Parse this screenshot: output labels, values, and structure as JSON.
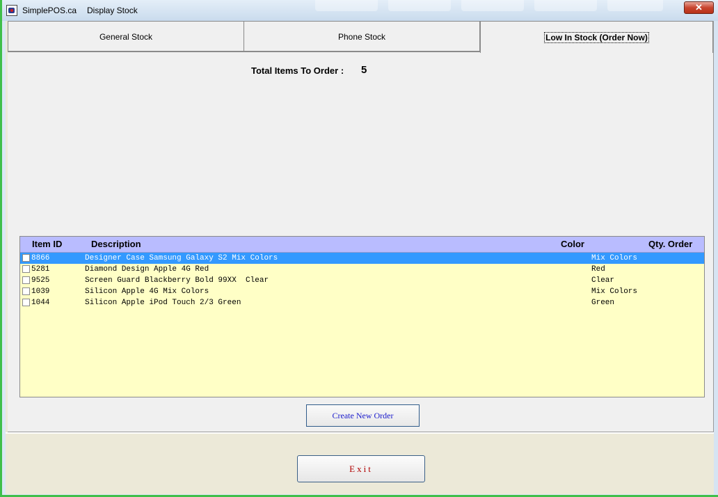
{
  "window": {
    "app_name": "SimplePOS.ca",
    "title": "Display Stock",
    "close_label": "✕"
  },
  "tabs": [
    {
      "label": "General Stock",
      "active": false
    },
    {
      "label": "Phone Stock",
      "active": false
    },
    {
      "label": "Low In Stock (Order Now)",
      "active": true
    }
  ],
  "summary": {
    "total_label": "Total Items To Order :",
    "total_value": "5"
  },
  "grid": {
    "headers": {
      "item_id": "Item ID",
      "description": "Description",
      "color": "Color",
      "qty": "Qty. Order"
    },
    "rows": [
      {
        "id": "8866",
        "description": "Designer Case Samsung Galaxy S2 Mix Colors",
        "color": "Mix Colors",
        "qty": "",
        "selected": true
      },
      {
        "id": "5281",
        "description": "Diamond Design Apple 4G Red",
        "color": "Red",
        "qty": "",
        "selected": false
      },
      {
        "id": "9525",
        "description": "Screen Guard Blackberry Bold 99XX  Clear",
        "color": "Clear",
        "qty": "",
        "selected": false
      },
      {
        "id": "1039",
        "description": "Silicon Apple 4G Mix Colors",
        "color": "Mix Colors",
        "qty": "",
        "selected": false
      },
      {
        "id": "1044",
        "description": "Silicon Apple iPod Touch 2/3 Green",
        "color": "Green",
        "qty": "",
        "selected": false
      }
    ]
  },
  "buttons": {
    "create_order": "Create New Order",
    "exit": "Exit"
  },
  "colors": {
    "grid_background": "#ffffc6",
    "grid_header": "#b9bcff",
    "selection": "#3399ff",
    "create_text": "#1a1acc",
    "exit_text": "#b00000"
  }
}
